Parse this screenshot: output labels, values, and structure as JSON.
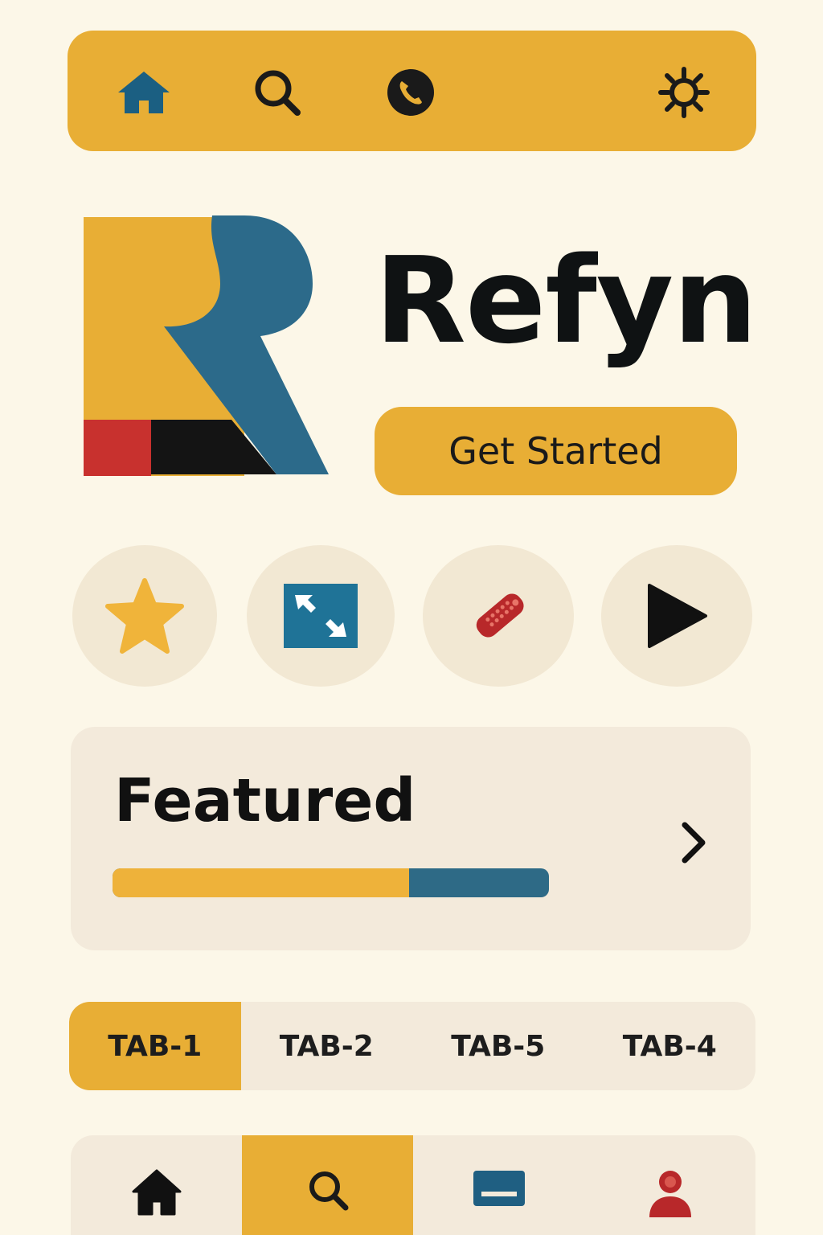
{
  "top_bar": {
    "icons": [
      "home-icon",
      "search-icon",
      "phone-icon",
      "settings-icon"
    ],
    "background": "#e8ae35"
  },
  "hero": {
    "brand_name": "Refyn",
    "cta_label": "Get Started",
    "logo_colors": [
      "#e8ae35",
      "#2c6a8a",
      "#c8312e",
      "#141414"
    ]
  },
  "quick_actions": [
    {
      "icon": "star-icon",
      "color": "#f0b43a"
    },
    {
      "icon": "expand-icon",
      "color": "#1f7397"
    },
    {
      "icon": "remote-icon",
      "color": "#b8282a"
    },
    {
      "icon": "play-icon",
      "color": "#111111"
    }
  ],
  "featured": {
    "title": "Featured",
    "progress": 0.68
  },
  "tabs": {
    "items": [
      "TAB-1",
      "TAB-2",
      "TAB-5",
      "TAB-4"
    ],
    "active_index": 0
  },
  "bottom_nav": {
    "items": [
      "home-icon",
      "search-icon",
      "card-icon",
      "user-icon"
    ],
    "active_index": 1
  },
  "colors": {
    "accent": "#e8ae35",
    "blue": "#2e6a86",
    "red": "#b8282a",
    "background": "#fcf7e8",
    "surface": "#f3eadb"
  }
}
